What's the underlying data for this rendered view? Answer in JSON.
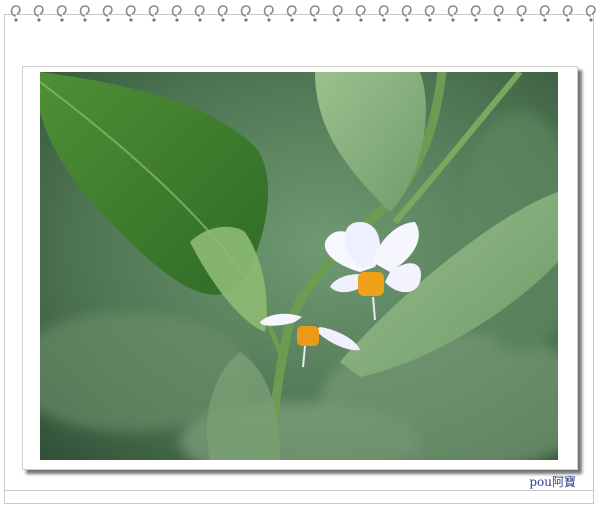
{
  "photo": {
    "subject": "",
    "colors": {
      "background": "#4f7a52",
      "leaf": "#5f9a47",
      "petal": "#f6f6ff",
      "anther": "#f0a11a"
    }
  },
  "watermark": {
    "text": "pou阿寶"
  },
  "frame": {
    "binding": "spiral-rings",
    "ring_count": 26
  }
}
